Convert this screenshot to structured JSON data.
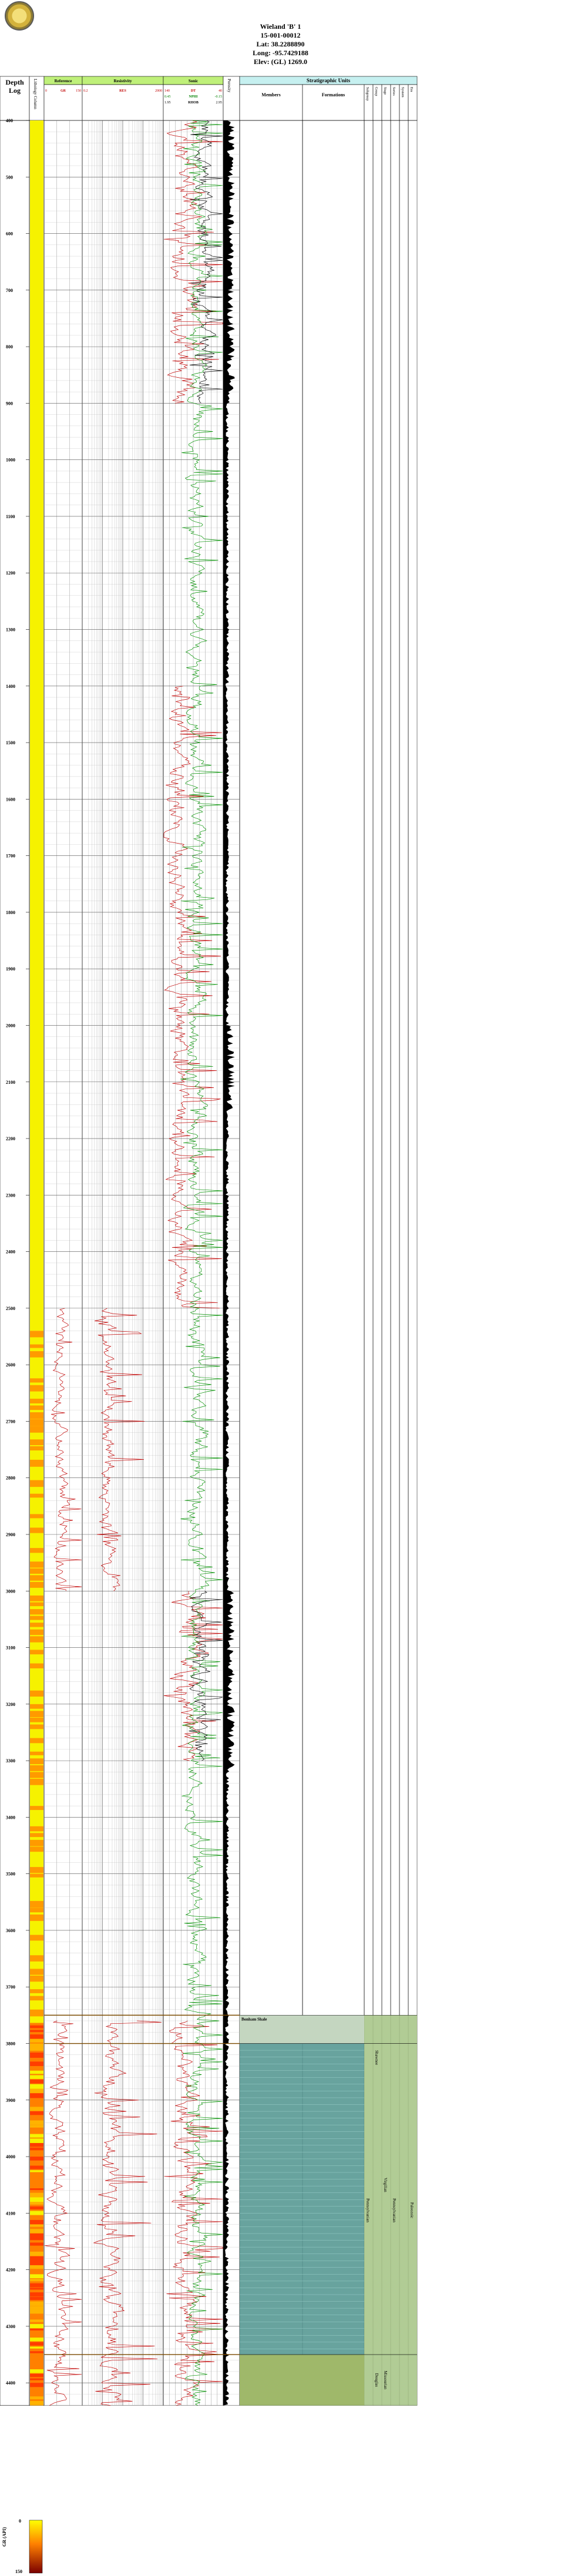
{
  "header": {
    "well_name": "Wieland 'B' 1",
    "api": "15-001-00012",
    "lat": "Lat: 38.2288890",
    "long": "Long: -95.7429188",
    "elev": "Elev: (GL) 1269.0"
  },
  "track_titles": {
    "depth": "Depth",
    "log": "Log",
    "lithology": "Lithology Column",
    "reference": "Reference",
    "resistivity": "Resistivity",
    "sonic": "Sonic",
    "porosity": "Porosity",
    "strat": "Stratigraphic Units",
    "members": "Members",
    "formations": "Formations",
    "right_cols": [
      "Subgroup",
      "Group",
      "Stage",
      "Series",
      "System",
      "Era"
    ]
  },
  "curve_labels": {
    "gr": {
      "left": "0",
      "name": "GR",
      "right": "150",
      "unit": "API"
    },
    "res": {
      "left": "0.2",
      "name": "RES",
      "right": "2000",
      "unit": "OHM-M"
    },
    "dt": {
      "left": "140",
      "name": "DT",
      "right": "40",
      "unit": "USEC/FT"
    },
    "nphi": {
      "left": "0.45",
      "name": "NPHI",
      "right": "-0.15"
    },
    "rhob": {
      "left": "1.95",
      "name": "RHOB",
      "right": "2.95"
    }
  },
  "strat_units": {
    "members": [
      {
        "name": "Bonham Shale",
        "top": 3750,
        "base": 3800
      }
    ],
    "formations": [
      {
        "name": "",
        "top": 3750,
        "base": 4440
      }
    ],
    "subgroups": [
      {
        "name": "Pennsylvanian",
        "top": 3750,
        "base": 4440
      }
    ],
    "groups": [
      {
        "name": "Shawnee",
        "top": 3750,
        "base": 3900
      },
      {
        "name": "Douglas",
        "top": 4350,
        "base": 4440
      }
    ],
    "stages": [
      {
        "name": "Virgilian",
        "top": 3750,
        "base": 4350
      },
      {
        "name": "Missourian",
        "top": 4350,
        "base": 4440
      }
    ],
    "series": [
      {
        "name": "Pennsylvanian",
        "top": 3750,
        "base": 4440
      }
    ],
    "system": [
      {
        "name": "Paleozoic",
        "top": 3750,
        "base": 4440
      }
    ]
  },
  "legend": {
    "label": "GR (API)",
    "min": "0",
    "max": "150"
  },
  "chart_data": {
    "type": "line",
    "depth_range": [
      400,
      4440
    ],
    "depth_ticks": [
      400,
      500,
      600,
      700,
      800,
      900,
      1000,
      1100,
      1200,
      1300,
      1400,
      1500,
      1600,
      1700,
      1800,
      1900,
      2000,
      2100,
      2200,
      2300,
      2400,
      2500,
      2600,
      2700,
      2800,
      2900,
      3000,
      3100,
      3200,
      3300,
      3400,
      3500,
      3600,
      3700,
      3800,
      3900,
      4000,
      4100,
      4200,
      4300,
      4400
    ],
    "lithology_bands": [
      {
        "top": 400,
        "base": 2540,
        "color": "#f6f200"
      },
      {
        "top": 2540,
        "base": 3760,
        "color": "#f6f200",
        "dashed_orange": true
      },
      {
        "top": 3760,
        "base": 4440,
        "color": "#ff8000"
      }
    ],
    "gr_interval": [
      2500,
      4440
    ],
    "res_interval": [
      2500,
      4440
    ],
    "sonic_interval": [
      400,
      4440
    ],
    "porosity_interval": [
      400,
      4440
    ],
    "strat_colored_interval": {
      "top": 3750,
      "base": 4440,
      "color": "#5b9b96"
    },
    "tops_markers": [
      3750,
      3800,
      4350
    ]
  }
}
